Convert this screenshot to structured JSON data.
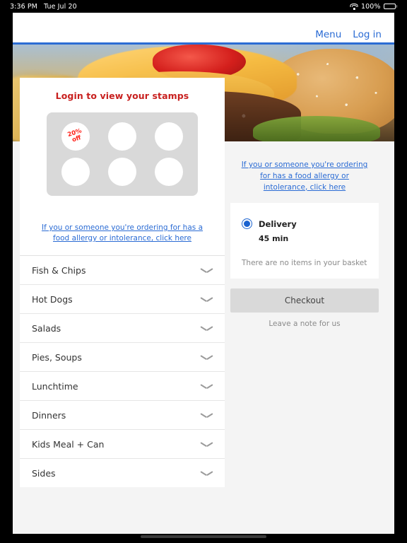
{
  "status_bar": {
    "time": "3:36 PM",
    "date": "Tue Jul 20",
    "wifi_icon": "wifi-icon",
    "battery_percent": "100%",
    "battery_icon": "battery-icon"
  },
  "header": {
    "nav": [
      {
        "label": "Menu"
      },
      {
        "label": "Log in"
      }
    ],
    "accent_color": "#2b6cd4"
  },
  "hero": {
    "alt": "cheeseburger-photo"
  },
  "stamps": {
    "title": "Login to view your stamps",
    "title_color": "#c8201f",
    "stamps": [
      {
        "label_line1": "20%",
        "label_line2": "off",
        "filled": true
      },
      {
        "label_line1": "",
        "label_line2": "",
        "filled": false
      },
      {
        "label_line1": "",
        "label_line2": "",
        "filled": false
      },
      {
        "label_line1": "",
        "label_line2": "",
        "filled": false
      },
      {
        "label_line1": "",
        "label_line2": "",
        "filled": false
      },
      {
        "label_line1": "",
        "label_line2": "",
        "filled": false
      }
    ]
  },
  "allergy_left": {
    "text": "If you or someone you're ordering for has a food allergy or intolerance, click here"
  },
  "allergy_right": {
    "text": "If you or someone you're ordering for has a food allergy or intolerance, click here"
  },
  "categories": [
    {
      "label": "Fish & Chips",
      "chevron": "chevron-down-icon"
    },
    {
      "label": "Hot Dogs",
      "chevron": "chevron-down-icon"
    },
    {
      "label": "Salads",
      "chevron": "chevron-down-icon"
    },
    {
      "label": "Pies, Soups",
      "chevron": "chevron-down-icon"
    },
    {
      "label": "Lunchtime",
      "chevron": "chevron-down-icon"
    },
    {
      "label": "Dinners",
      "chevron": "chevron-down-icon"
    },
    {
      "label": "Kids Meal + Can",
      "chevron": "chevron-down-icon"
    },
    {
      "label": "Sides",
      "chevron": "chevron-down-icon"
    }
  ],
  "basket": {
    "delivery_label": "Delivery",
    "delivery_selected": true,
    "delivery_time": "45 min",
    "empty_message": "There are no items in your basket",
    "checkout_label": "Checkout",
    "note_label": "Leave a note for us",
    "radio_color": "#1a62cf"
  }
}
